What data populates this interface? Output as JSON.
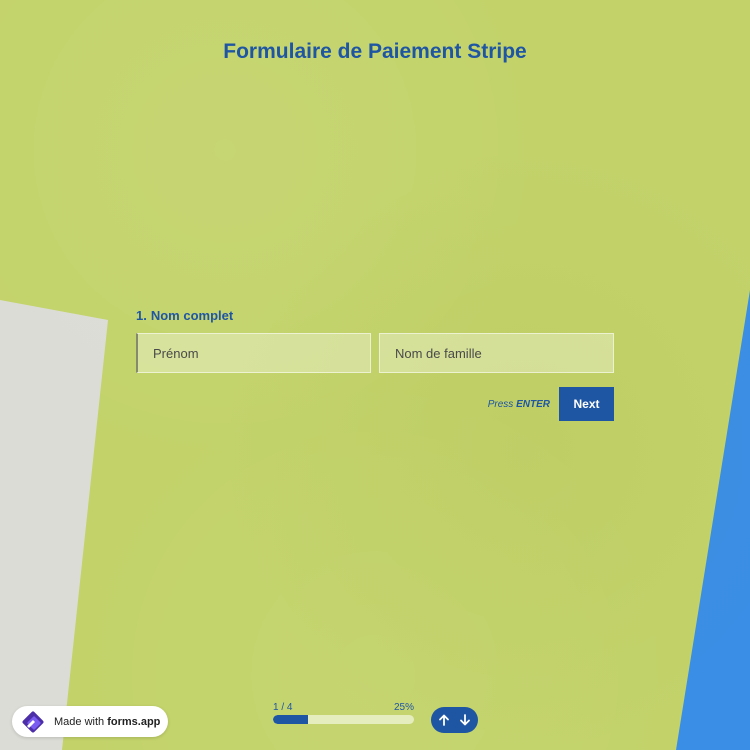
{
  "form": {
    "title": "Formulaire de Paiement Stripe"
  },
  "question": {
    "number": "1.",
    "label": "Nom complet",
    "first_name_placeholder": "Prénom",
    "last_name_placeholder": "Nom de famille"
  },
  "actions": {
    "press_text": "Press",
    "enter_text": "ENTER",
    "next_label": "Next"
  },
  "progress": {
    "step_text": "1 / 4",
    "percent_text": "25%",
    "fraction": 0.25
  },
  "badge": {
    "made_with": "Made with",
    "brand": "forms.app"
  },
  "icons": {
    "badge_logo": "forms-app-logo-icon",
    "up": "arrow-up-icon",
    "down": "arrow-down-icon"
  },
  "colors": {
    "accent": "#1f56a4",
    "background": "#c3d36a",
    "gray_shape": "#dcdcd6",
    "blue_shape": "#3a8ee6"
  }
}
